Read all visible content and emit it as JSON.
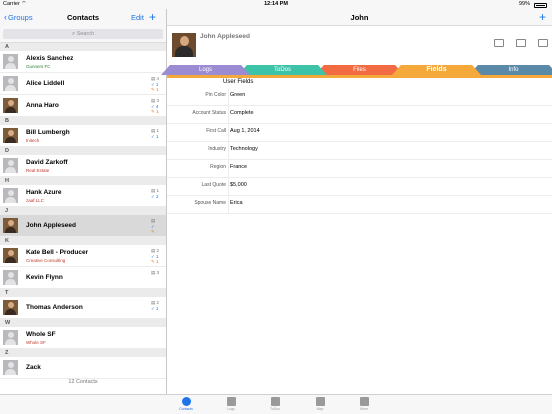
{
  "status_bar": {
    "carrier": "Carrier ⌔",
    "time": "12:14 PM",
    "battery": "99%"
  },
  "left_nav": {
    "back_label": "Groups",
    "title": "Contacts",
    "edit_label": "Edit",
    "add_label": "+"
  },
  "search": {
    "placeholder": "Search"
  },
  "sections": [
    "A",
    "B",
    "D",
    "H",
    "J",
    "K",
    "T",
    "W",
    "Z"
  ],
  "contacts": [
    {
      "name": "Alexis Sanchez",
      "company": "Gunners FC",
      "company_color": "green",
      "counts": [],
      "photo": false
    },
    {
      "name": "Alice Liddell",
      "company": "",
      "counts": [
        "4",
        "1",
        "1"
      ],
      "photo": false
    },
    {
      "name": "Anna Haro",
      "company": "",
      "counts": [
        "3",
        "4",
        "1"
      ],
      "photo": true
    },
    {
      "name": "Bill Lumbergh",
      "company": "Initech",
      "company_color": "red",
      "counts": [
        "1",
        "1"
      ],
      "photo": true
    },
    {
      "name": "David Zarkoff",
      "company": "Real Estate",
      "company_color": "red",
      "counts": [],
      "photo": false
    },
    {
      "name": "Hank Azure",
      "company": "zaaf LLC",
      "company_color": "red",
      "counts": [
        "1",
        "2"
      ],
      "photo": false
    },
    {
      "name": "John Appleseed",
      "company": "",
      "counts": [
        "",
        "",
        ""
      ],
      "photo": true
    },
    {
      "name": "Kate Bell - Producer",
      "company": "Creative Consulting",
      "company_color": "red",
      "counts": [
        "2",
        "1",
        "1"
      ],
      "photo": true
    },
    {
      "name": "Kevin Flynn",
      "company": "",
      "counts": [
        "3"
      ],
      "photo": false
    },
    {
      "name": "Thomas Anderson",
      "company": "",
      "counts": [
        "2",
        "1"
      ],
      "photo": true
    },
    {
      "name": "Whole SF",
      "company": "Whole SF",
      "company_color": "red",
      "counts": [],
      "photo": false
    },
    {
      "name": "Zack",
      "company": "",
      "counts": [],
      "photo": false
    }
  ],
  "list_footer": "12 Contacts",
  "right_nav": {
    "title": "John",
    "add_label": "+"
  },
  "detail": {
    "name": "John Appleseed"
  },
  "tabs": [
    {
      "label": "Logs",
      "color": "#9a8bd2"
    },
    {
      "label": "ToDos",
      "color": "#3dc3a8"
    },
    {
      "label": "Files",
      "color": "#f26b43"
    },
    {
      "label": "Fields",
      "color": "#f4a93a"
    },
    {
      "label": "Info",
      "color": "#5b8aa8"
    }
  ],
  "section_title": "User Fields",
  "fields": [
    {
      "label": "Pin Color",
      "value": "Green"
    },
    {
      "label": "Account Status",
      "value": "Complete"
    },
    {
      "label": "First Call",
      "value": "Aug 1, 2014"
    },
    {
      "label": "Industry",
      "value": "Technology"
    },
    {
      "label": "Region",
      "value": "France"
    },
    {
      "label": "Last Quote",
      "value": "$5,000"
    },
    {
      "label": "Spouse Name",
      "value": "Erica"
    }
  ],
  "tabbar": [
    {
      "label": "Contacts",
      "icon": "contacts-icon"
    },
    {
      "label": "Logs",
      "icon": "logs-icon"
    },
    {
      "label": "ToDos",
      "icon": "todos-icon"
    },
    {
      "label": "Map",
      "icon": "map-icon"
    },
    {
      "label": "More",
      "icon": "more-icon"
    }
  ]
}
